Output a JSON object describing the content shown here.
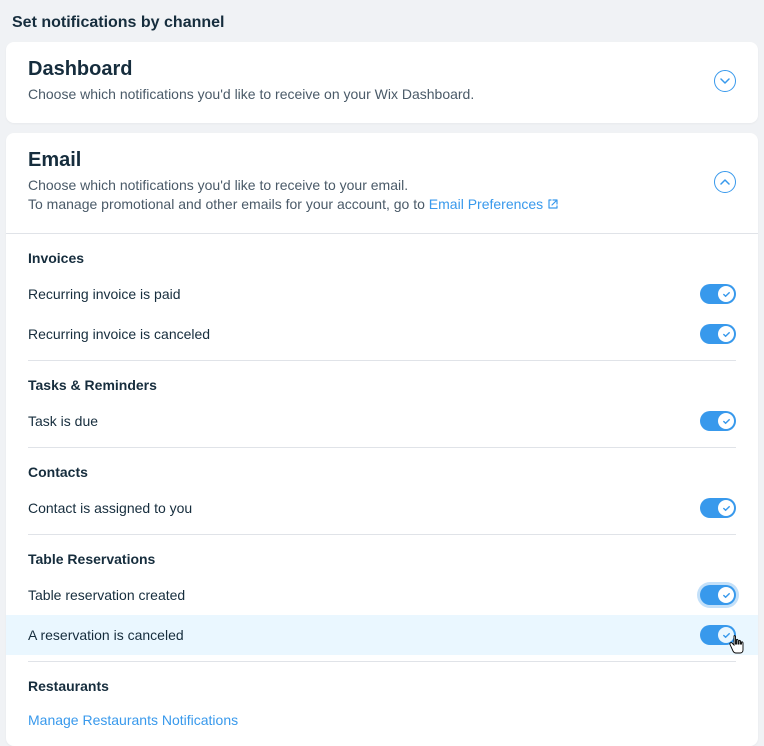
{
  "page": {
    "title": "Set notifications by channel"
  },
  "dashboard": {
    "title": "Dashboard",
    "desc": "Choose which notifications you'd like to receive on your Wix Dashboard."
  },
  "email": {
    "title": "Email",
    "desc_line1": "Choose which notifications you'd like to receive to your email.",
    "desc_line2_prefix": "To manage promotional and other emails for your account, go to ",
    "desc_line2_link": "Email Preferences",
    "groups": {
      "invoices": {
        "title": "Invoices",
        "items": [
          {
            "label": "Recurring invoice is paid",
            "on": true
          },
          {
            "label": "Recurring invoice is canceled",
            "on": true
          }
        ]
      },
      "tasks": {
        "title": "Tasks & Reminders",
        "items": [
          {
            "label": "Task is due",
            "on": true
          }
        ]
      },
      "contacts": {
        "title": "Contacts",
        "items": [
          {
            "label": "Contact is assigned to you",
            "on": true
          }
        ]
      },
      "table_reservations": {
        "title": "Table Reservations",
        "items": [
          {
            "label": "Table reservation created",
            "on": true
          },
          {
            "label": "A reservation is canceled",
            "on": true
          }
        ]
      },
      "restaurants": {
        "title": "Restaurants",
        "manage_link": "Manage Restaurants Notifications"
      }
    }
  }
}
